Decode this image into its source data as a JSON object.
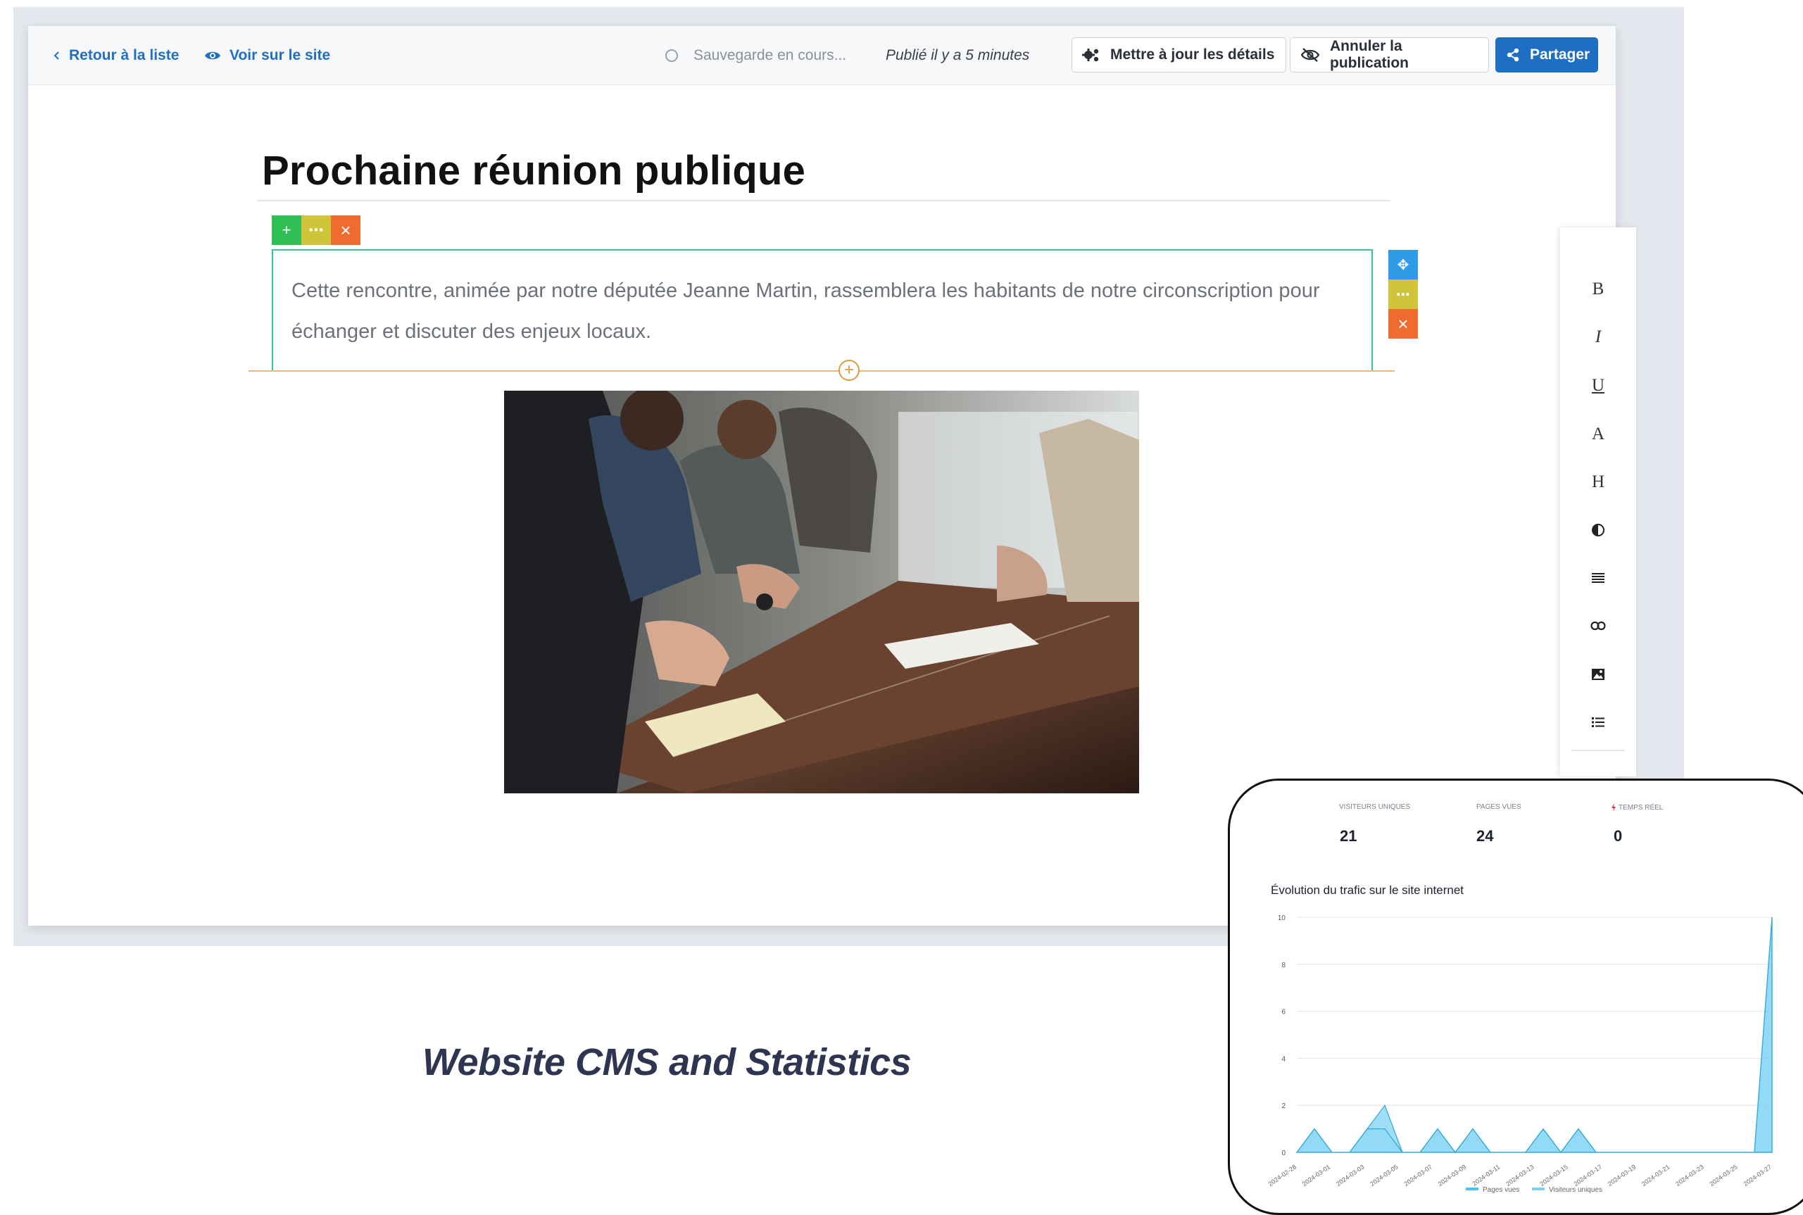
{
  "topbar": {
    "back_label": "Retour à la liste",
    "view_label": "Voir sur le site",
    "saving_label": "Sauvegarde en cours...",
    "published_label": "Publié il y a 5 minutes",
    "update_label": "Mettre à jour les détails",
    "unpublish_label": "Annuler la publication",
    "share_label": "Partager"
  },
  "editor": {
    "title": "Prochaine réunion publique",
    "paragraph": "Cette rencontre, animée par notre députée Jeanne Martin, rassemblera les habitants de notre circonscription pour échanger et discuter des enjeux locaux.",
    "block_tools": {
      "add": "+",
      "more": "⋯",
      "delete": "×"
    },
    "side_tools": {
      "move": "✥",
      "more": "⋯",
      "delete": "×"
    },
    "insert_plus": "+"
  },
  "format_toolbar": {
    "bold": "B",
    "italic": "I",
    "underline": "U",
    "font": "A",
    "heading": "H"
  },
  "colors": {
    "green": "#2fbf55",
    "yellow": "#cfc43a",
    "orange": "#ef6b2e",
    "blue": "#2f9be6",
    "primary": "#1e6fc4",
    "accent_line": "#34c39a"
  },
  "caption": "Website CMS  and Statistics",
  "stats": {
    "kpis": [
      {
        "label": "VISITEURS UNIQUES",
        "value": "21"
      },
      {
        "label": "PAGES VUES",
        "value": "24"
      },
      {
        "label": "TEMPS RÉEL",
        "value": "0"
      }
    ]
  },
  "chart_data": {
    "type": "area",
    "title": "Évolution du trafic sur le site internet",
    "x": [
      "2024-02-28",
      "2024-03-01",
      "2024-03-03",
      "2024-03-05",
      "2024-03-07",
      "2024-03-09",
      "2024-03-11",
      "2024-03-13",
      "2024-03-15",
      "2024-03-17",
      "2024-03-19",
      "2024-03-21",
      "2024-03-23",
      "2024-03-25",
      "2024-03-27"
    ],
    "ylim": [
      0,
      10
    ],
    "yticks": [
      "0",
      "2",
      "4",
      "6",
      "8",
      "10"
    ],
    "series": [
      {
        "name": "Pages vues",
        "values": [
          0,
          1,
          0,
          0,
          1,
          2,
          0,
          0,
          1,
          0,
          1,
          0,
          0,
          0,
          1,
          0,
          1,
          0,
          0,
          0,
          0,
          0,
          0,
          0,
          0,
          0,
          0,
          10
        ],
        "color": "#4fc3f0"
      },
      {
        "name": "Visiteurs uniques",
        "values": [
          0,
          1,
          0,
          0,
          1,
          1,
          0,
          0,
          1,
          0,
          1,
          0,
          0,
          0,
          1,
          0,
          1,
          0,
          0,
          0,
          0,
          0,
          0,
          0,
          0,
          0,
          0,
          10
        ],
        "color": "#7fd3f4"
      }
    ],
    "legend": "bottom",
    "grid": true
  }
}
